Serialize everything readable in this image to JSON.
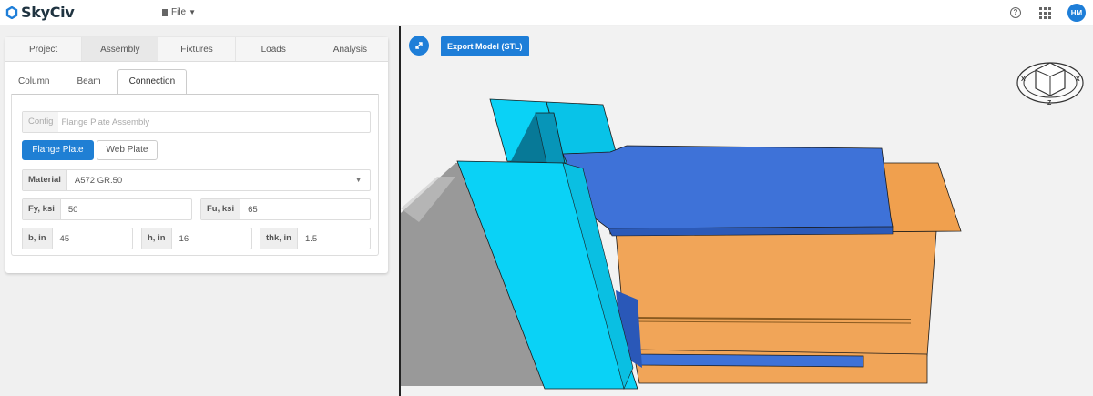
{
  "app": {
    "logo_text": "SkyCiv",
    "file_menu": "File",
    "user_initials": "HM"
  },
  "main_tabs": [
    {
      "label": "Project"
    },
    {
      "label": "Assembly"
    },
    {
      "label": "Fixtures"
    },
    {
      "label": "Loads"
    },
    {
      "label": "Analysis"
    }
  ],
  "sub_tabs": [
    {
      "label": "Column"
    },
    {
      "label": "Beam"
    },
    {
      "label": "Connection"
    }
  ],
  "config": {
    "label": "Config",
    "value": "Flange Plate Assembly"
  },
  "plate_buttons": {
    "flange": "Flange Plate",
    "web": "Web Plate"
  },
  "material": {
    "label": "Material",
    "value": "A572 GR.50"
  },
  "fy": {
    "label": "Fy, ksi",
    "value": "50"
  },
  "fu": {
    "label": "Fu, ksi",
    "value": "65"
  },
  "b": {
    "label": "b, in",
    "value": "45"
  },
  "h": {
    "label": "h, in",
    "value": "16"
  },
  "thk": {
    "label": "thk, in",
    "value": "1.5"
  },
  "viewport": {
    "export_label": "Export Model (STL)",
    "cube_labels": {
      "x1": "X",
      "x2": "X",
      "z": "Z"
    }
  },
  "colors": {
    "accent": "#1e7ed8",
    "column": "#0dd0f5",
    "plate": "#3e72d8",
    "beam": "#f0a455"
  }
}
